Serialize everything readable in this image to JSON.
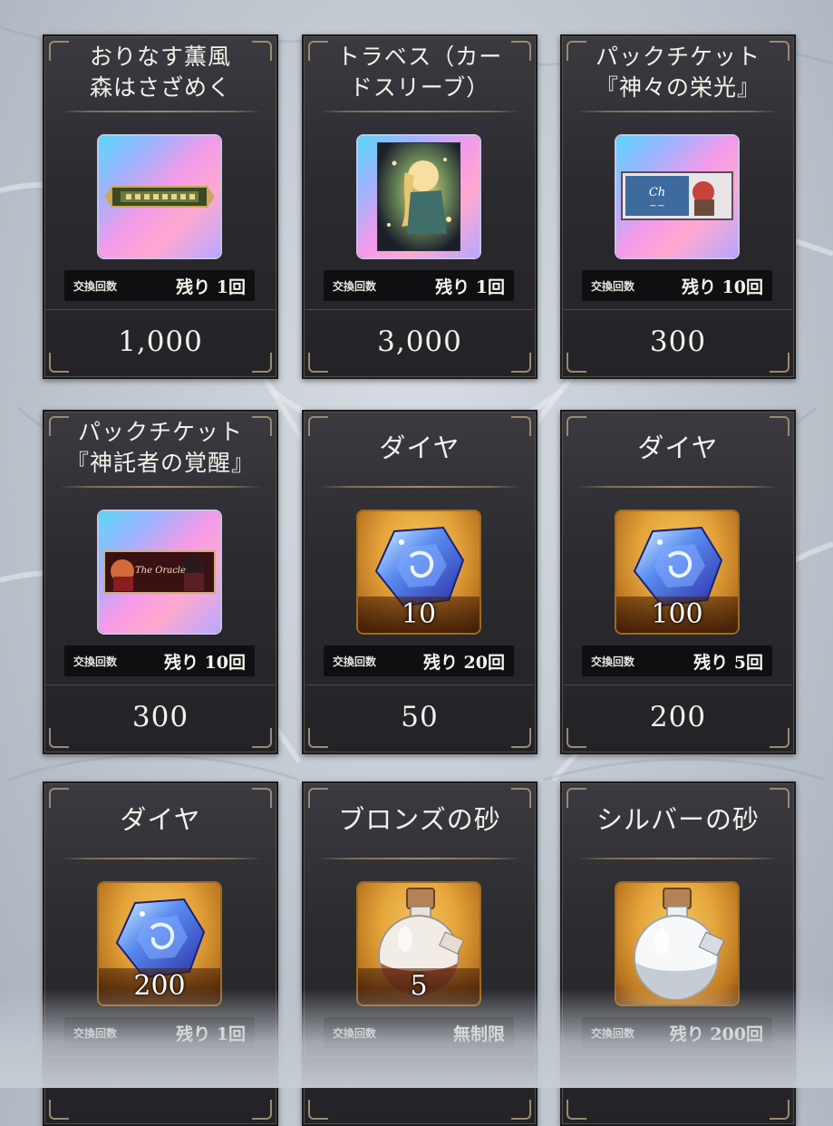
{
  "items": [
    {
      "title_lines": [
        "おりなす薫風",
        "森はさざめく"
      ],
      "art": "sleeve-banner-icon",
      "frame": "holo",
      "count_label": "交換回数",
      "remaining": "残り 1回",
      "price": "1,000"
    },
    {
      "title_lines": [
        "トラベス（カー",
        "ドスリーブ）"
      ],
      "art": "card-sleeve-portrait-icon",
      "frame": "holo",
      "count_label": "交換回数",
      "remaining": "残り 1回",
      "price": "3,000"
    },
    {
      "title_lines": [
        "パックチケット",
        "『神々の栄光』"
      ],
      "art": "pack-ticket-icon",
      "frame": "holo",
      "count_label": "交換回数",
      "remaining": "残り 10回",
      "price": "300"
    },
    {
      "title_lines": [
        "パックチケット",
        "『神託者の覚醒』"
      ],
      "art": "pack-ticket-oracle-icon",
      "art_text": "The Oracle",
      "frame": "holo",
      "count_label": "交換回数",
      "remaining": "残り 10回",
      "price": "300"
    },
    {
      "title_lines": [
        "ダイヤ"
      ],
      "art": "diamond-icon",
      "frame": "gold",
      "quantity": "10",
      "count_label": "交換回数",
      "remaining": "残り 20回",
      "price": "50"
    },
    {
      "title_lines": [
        "ダイヤ"
      ],
      "art": "diamond-icon",
      "frame": "gold",
      "quantity": "100",
      "count_label": "交換回数",
      "remaining": "残り 5回",
      "price": "200"
    },
    {
      "title_lines": [
        "ダイヤ"
      ],
      "art": "diamond-icon",
      "frame": "gold",
      "quantity": "200",
      "count_label": "交換回数",
      "remaining": "残り 1回",
      "price": ""
    },
    {
      "title_lines": [
        "ブロンズの砂"
      ],
      "art": "bronze-sand-bottle-icon",
      "frame": "gold",
      "quantity": "5",
      "count_label": "交換回数",
      "remaining": "無制限",
      "price": ""
    },
    {
      "title_lines": [
        "シルバーの砂"
      ],
      "art": "silver-sand-bottle-icon",
      "frame": "gold",
      "count_label": "交換回数",
      "remaining": "残り 200回",
      "price": ""
    }
  ]
}
